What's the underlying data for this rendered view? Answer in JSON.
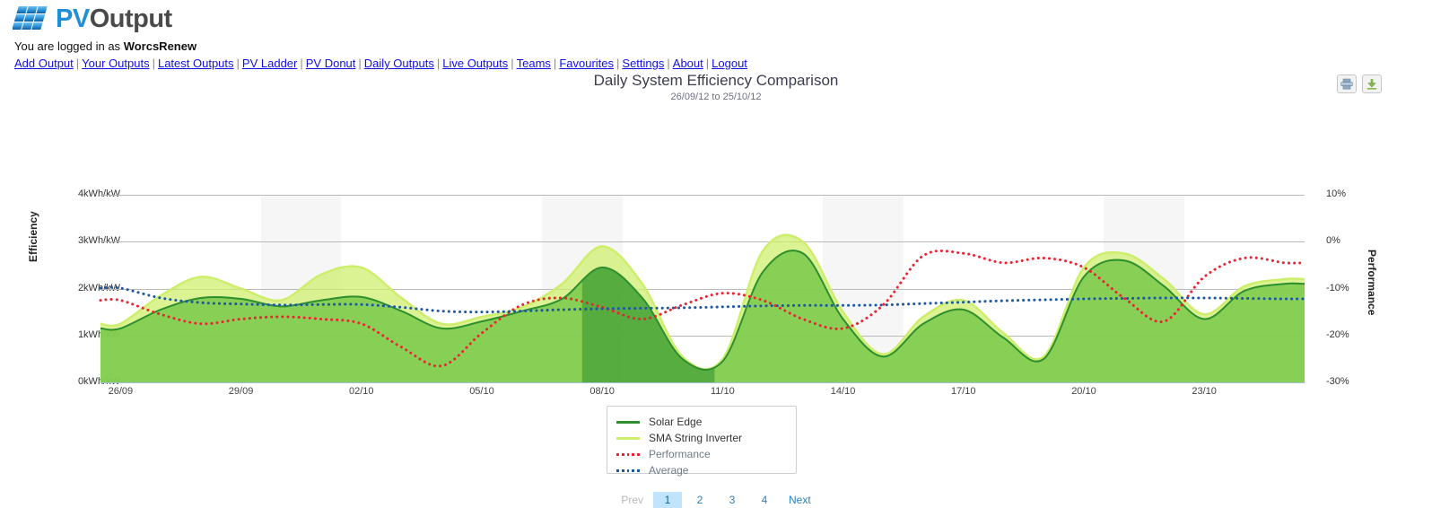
{
  "brand": {
    "name_pv": "PV",
    "name_output": "Output",
    "logo_icon": "solar-panel-icon"
  },
  "session": {
    "prefix": "You are logged in as",
    "username": "WorcsRenew"
  },
  "nav": {
    "separator": "|",
    "items": [
      {
        "label": "Add Output"
      },
      {
        "label": "Your Outputs"
      },
      {
        "label": "Latest Outputs"
      },
      {
        "label": "PV Ladder"
      },
      {
        "label": "PV Donut"
      },
      {
        "label": "Daily Outputs"
      },
      {
        "label": "Live Outputs"
      },
      {
        "label": "Teams"
      },
      {
        "label": "Favourites"
      },
      {
        "label": "Settings"
      },
      {
        "label": "About"
      },
      {
        "label": "Logout"
      }
    ]
  },
  "toolbar": {
    "print_icon": "print-icon",
    "download_icon": "download-icon"
  },
  "pager": {
    "prev": "Prev",
    "next": "Next",
    "pages": [
      "1",
      "2",
      "3",
      "4"
    ],
    "active": "1"
  },
  "colors": {
    "solar_edge": "#2f8f2f",
    "sma_string": "#cdee6a",
    "sma_fill": "#8ed94a",
    "performance": "#ee2233",
    "average": "#1d57a5",
    "grid": "#b9b9b9",
    "weekend_band": "#f6f6f6",
    "link": "#1111dd"
  },
  "chart_data": {
    "type": "area",
    "title": "Daily System Efficiency Comparison",
    "subtitle": "26/09/12 to 25/10/12",
    "xlabel": "",
    "ylabel": "Efficiency",
    "ylabel_right": "Performance",
    "grid": true,
    "legend_position": "bottom-center",
    "y_left": {
      "label": "Efficiency",
      "ticks": [
        "0kWh/kW",
        "1kWh/kW",
        "2kWh/kW",
        "3kWh/kW",
        "4kWh/kW"
      ],
      "values": [
        0,
        1,
        2,
        3,
        4
      ],
      "ylim": [
        0,
        4
      ],
      "unit": "kWh/kW"
    },
    "y_right": {
      "label": "Performance",
      "ticks": [
        "-30%",
        "-20%",
        "-10%",
        "0%",
        "10%"
      ],
      "values": [
        -30,
        -20,
        -10,
        0,
        10
      ],
      "ylim": [
        -30,
        10
      ],
      "unit": "%"
    },
    "x": {
      "tick_labels": [
        "26/09",
        "29/09",
        "02/10",
        "05/10",
        "08/10",
        "11/10",
        "14/10",
        "17/10",
        "20/10",
        "23/10"
      ],
      "start": "26/09/12",
      "end": "25/10/12",
      "days": 30
    },
    "series": [
      {
        "name": "Solar Edge",
        "type": "area",
        "color": "#2f8f2f",
        "unit": "kWh/kW",
        "axis": "left",
        "values": [
          1.15,
          1.55,
          1.8,
          1.78,
          1.62,
          1.75,
          1.82,
          1.52,
          1.15,
          1.3,
          1.52,
          1.78,
          2.45,
          1.8,
          0.5,
          0.45,
          2.35,
          2.75,
          1.35,
          0.55,
          1.25,
          1.55,
          0.95,
          0.5,
          2.25,
          2.6,
          2.05,
          1.35,
          1.95,
          2.1
        ]
      },
      {
        "name": "SMA String Inverter",
        "type": "area",
        "color": "#cdee6a",
        "unit": "kWh/kW",
        "axis": "left",
        "values": [
          1.25,
          1.85,
          2.25,
          2.0,
          1.75,
          2.3,
          2.45,
          1.8,
          1.25,
          1.4,
          1.6,
          2.1,
          2.9,
          2.1,
          0.55,
          0.5,
          2.8,
          3.0,
          1.5,
          0.6,
          1.4,
          1.75,
          1.05,
          0.55,
          2.45,
          2.75,
          2.2,
          1.45,
          2.05,
          2.2
        ]
      },
      {
        "name": "Performance",
        "type": "line",
        "style": "dotted",
        "color": "#ee2233",
        "unit": "%",
        "axis": "right",
        "values": [
          -12.5,
          -15.5,
          -17.5,
          -16.5,
          -16.0,
          -16.5,
          -17.5,
          -22.5,
          -26.5,
          -19.5,
          -13.5,
          -12.0,
          -14.0,
          -16.5,
          -13.5,
          -11.0,
          -12.5,
          -16.5,
          -18.5,
          -13.5,
          -3.0,
          -2.5,
          -4.5,
          -3.5,
          -5.5,
          -12.0,
          -17.0,
          -7.5,
          -3.5,
          -4.5
        ]
      },
      {
        "name": "Average",
        "type": "line",
        "style": "dotted",
        "color": "#1d57a5",
        "unit": "%",
        "axis": "right",
        "values": [
          -9.9,
          -12.0,
          -13.0,
          -13.3,
          -13.5,
          -13.4,
          -13.4,
          -14.0,
          -14.8,
          -15.0,
          -14.8,
          -14.5,
          -14.3,
          -14.2,
          -14.1,
          -13.9,
          -13.7,
          -13.6,
          -13.6,
          -13.5,
          -13.2,
          -12.9,
          -12.6,
          -12.4,
          -12.2,
          -12.1,
          -12.0,
          -12.0,
          -12.1,
          -12.2
        ]
      }
    ],
    "weekend_bands": [
      {
        "start_day": 4,
        "end_day": 5
      },
      {
        "start_day": 11,
        "end_day": 12
      },
      {
        "start_day": 18,
        "end_day": 19
      },
      {
        "start_day": 25,
        "end_day": 26
      }
    ]
  }
}
